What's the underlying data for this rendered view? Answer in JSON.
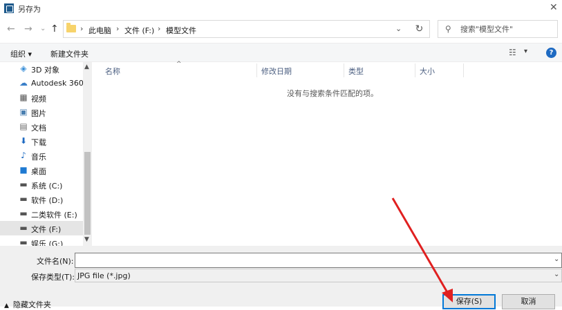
{
  "window": {
    "title": "另存为",
    "close_glyph": "✕"
  },
  "nav": {
    "back": "←",
    "forward": "→",
    "recent": "⌄",
    "up": "↑",
    "refresh": "↻"
  },
  "address": {
    "crumbs": [
      "此电脑",
      "文件 (F:)",
      "模型文件"
    ],
    "separator": "›",
    "dropdown": "⌄"
  },
  "search": {
    "placeholder": "搜索\"模型文件\"",
    "icon": "search-icon"
  },
  "toolbar": {
    "organize": "组织 ▾",
    "new_folder": "新建文件夹",
    "view_icon": "☷",
    "view_drop": "▾",
    "help": "?"
  },
  "sidebar": {
    "items": [
      {
        "label": "3D 对象",
        "icon": "cube-icon",
        "glyph": "◈",
        "color": "#3a8fd8"
      },
      {
        "label": "Autodesk 360",
        "icon": "cloud-icon",
        "glyph": "☁",
        "color": "#3a7fc8"
      },
      {
        "label": "视频",
        "icon": "video-icon",
        "glyph": "▦",
        "color": "#555555"
      },
      {
        "label": "图片",
        "icon": "picture-icon",
        "glyph": "▣",
        "color": "#4a7fb0"
      },
      {
        "label": "文档",
        "icon": "document-icon",
        "glyph": "▤",
        "color": "#6a6a6a"
      },
      {
        "label": "下载",
        "icon": "download-icon",
        "glyph": "⬇",
        "color": "#1e6ac2"
      },
      {
        "label": "音乐",
        "icon": "music-icon",
        "glyph": "♪",
        "color": "#1e6ac2"
      },
      {
        "label": "桌面",
        "icon": "desktop-icon",
        "glyph": "■",
        "color": "#1e7ad2"
      },
      {
        "label": "系统 (C:)",
        "icon": "drive-icon",
        "glyph": "▬",
        "color": "#555555"
      },
      {
        "label": "软件 (D:)",
        "icon": "drive-icon",
        "glyph": "▬",
        "color": "#555555"
      },
      {
        "label": "二类软件 (E:)",
        "icon": "drive-icon",
        "glyph": "▬",
        "color": "#555555"
      },
      {
        "label": "文件 (F:)",
        "icon": "drive-icon",
        "glyph": "▬",
        "color": "#555555",
        "selected": true
      },
      {
        "label": "娱乐 (G:)",
        "icon": "drive-icon",
        "glyph": "▬",
        "color": "#555555"
      }
    ],
    "scroll_up": "▲",
    "scroll_down": "▼"
  },
  "list": {
    "columns": [
      "名称",
      "修改日期",
      "类型",
      "大小"
    ],
    "sort_glyph": "^",
    "empty_text": "没有与搜索条件匹配的项。"
  },
  "form": {
    "filename_label": "文件名(N):",
    "filename_value": "",
    "filetype_label": "保存类型(T):",
    "filetype_value": "JPG file (*.jpg)",
    "dropdown": "⌄"
  },
  "footer": {
    "hide_folders": "隐藏文件夹",
    "chevron": "▲",
    "save": "保存(S)",
    "cancel": "取消"
  },
  "annotation": {
    "color": "#e02020"
  }
}
